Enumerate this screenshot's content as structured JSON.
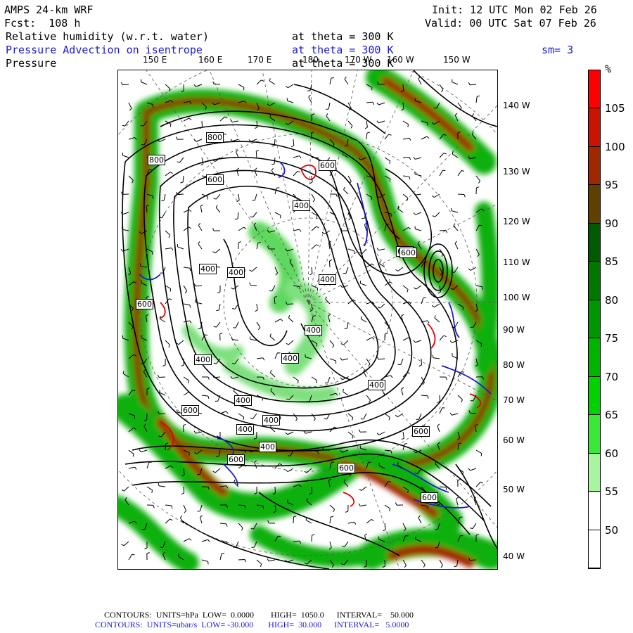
{
  "header": {
    "model": "AMPS 24-km WRF",
    "forecast": "Fcst:  108 h",
    "init": "Init: 12 UTC Mon 02 Feb 26",
    "valid": "Valid: 00 UTC Sat 07 Feb 26",
    "field1_name": "Relative humidity (w.r.t. water)",
    "field1_level": "at theta = 300 K",
    "field2_name": "Pressure Advection on isentrope",
    "field2_level": "at theta = 300 K",
    "field2_smooth": "sm= 3",
    "field3_name": "Pressure",
    "field3_level": "at theta = 300 K"
  },
  "top_longitudes": [
    "150 E",
    "160 E",
    "170 E",
    "180",
    "170 W",
    "160 W",
    "150 W"
  ],
  "right_longitudes": [
    "140 W",
    "130 W",
    "120 W",
    "110 W",
    "100 W",
    "90 W",
    "80 W",
    "70 W",
    "60 W",
    "50 W",
    "40 W"
  ],
  "colorbar": {
    "unit": "%",
    "labels": [
      "105",
      "100",
      "95",
      "90",
      "85",
      "80",
      "75",
      "70",
      "65",
      "60",
      "55",
      "50"
    ],
    "colors": [
      "#ff0000",
      "#c81400",
      "#a02800",
      "#604000",
      "#005a00",
      "#007800",
      "#009600",
      "#00b400",
      "#00d200",
      "#3ae83a",
      "#a8f5a0",
      "#ffffff",
      "#ffffff"
    ]
  },
  "pressure_labels": [
    "800",
    "800",
    "600",
    "600",
    "600",
    "400",
    "400",
    "400",
    "400",
    "400",
    "400",
    "400",
    "400",
    "400",
    "400",
    "400",
    "400",
    "600",
    "600",
    "600",
    "600",
    "600",
    "600",
    "600"
  ],
  "footer": {
    "line1": "CONTOURS:  UNITS=hPa  LOW=  0.0000        HIGH=  1050.0      INTERVAL=    50.000",
    "line2": "CONTOURS:  UNITS=ubar/s  LOW= -30.000       HIGH=  30.000      INTERVAL=   5.0000"
  }
}
